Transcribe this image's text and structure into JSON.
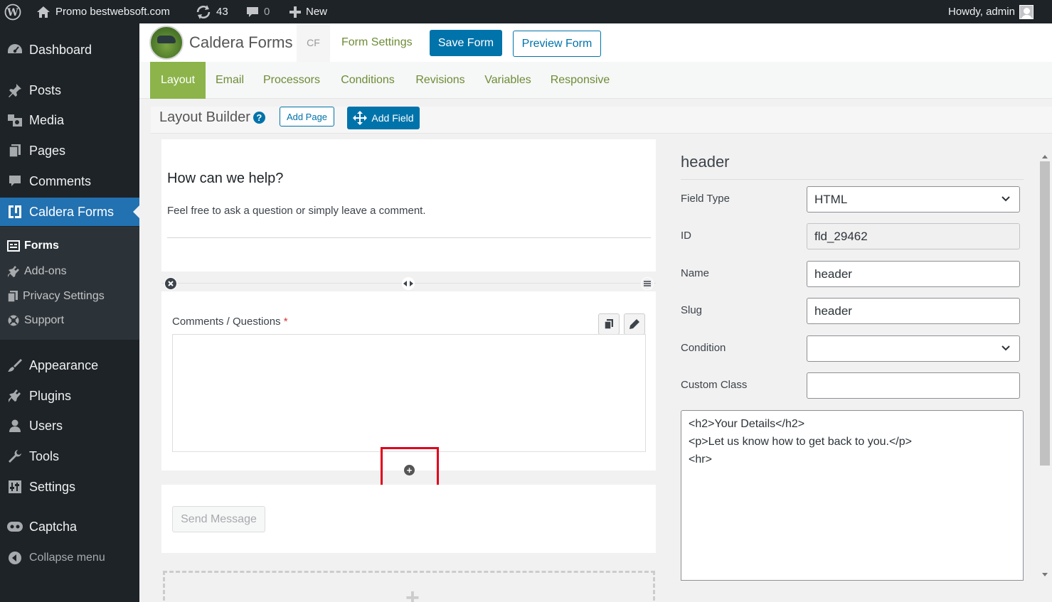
{
  "adminbar": {
    "site_name": "Promo bestwebsoft.com",
    "updates_count": "43",
    "comments_count": "0",
    "new_label": "New",
    "howdy": "Howdy, admin"
  },
  "sidebar": {
    "items": [
      {
        "label": "Dashboard",
        "icon": "dashboard-icon"
      },
      {
        "label": "Posts",
        "icon": "pin-icon"
      },
      {
        "label": "Media",
        "icon": "media-icon"
      },
      {
        "label": "Pages",
        "icon": "pages-icon"
      },
      {
        "label": "Comments",
        "icon": "comment-icon"
      },
      {
        "label": "Caldera Forms",
        "icon": "caldera-icon"
      },
      {
        "label": "Appearance",
        "icon": "brush-icon"
      },
      {
        "label": "Plugins",
        "icon": "plugin-icon"
      },
      {
        "label": "Users",
        "icon": "user-icon"
      },
      {
        "label": "Tools",
        "icon": "wrench-icon"
      },
      {
        "label": "Settings",
        "icon": "settings-icon"
      },
      {
        "label": "Captcha",
        "icon": "captcha-icon"
      }
    ],
    "submenu": [
      {
        "label": "Forms"
      },
      {
        "label": "Add-ons"
      },
      {
        "label": "Privacy Settings"
      },
      {
        "label": "Support"
      }
    ],
    "collapse_label": "Collapse menu"
  },
  "header": {
    "brand": "Caldera Forms",
    "tag": "CF",
    "form_settings": "Form Settings",
    "save_form": "Save Form",
    "preview_form": "Preview Form"
  },
  "tabs": [
    {
      "label": "Layout",
      "active": true
    },
    {
      "label": "Email"
    },
    {
      "label": "Processors"
    },
    {
      "label": "Conditions"
    },
    {
      "label": "Revisions"
    },
    {
      "label": "Variables"
    },
    {
      "label": "Responsive"
    }
  ],
  "builder": {
    "title": "Layout Builder",
    "help": "?",
    "add_page": "Add Page",
    "add_field": "Add Field"
  },
  "canvas": {
    "help_title": "How can we help?",
    "help_desc": "Feel free to ask a question or simply leave a comment.",
    "field_label": "Comments / Questions",
    "required_mark": "*",
    "send_button": "Send Message"
  },
  "config": {
    "title": "header",
    "field_type_label": "Field Type",
    "field_type_value": "HTML",
    "id_label": "ID",
    "id_value": "fld_29462",
    "name_label": "Name",
    "name_value": "header",
    "slug_label": "Slug",
    "slug_value": "header",
    "condition_label": "Condition",
    "condition_value": "",
    "custom_class_label": "Custom Class",
    "custom_class_value": "",
    "code_lines": [
      "<h2>Your Details</h2>",
      "<p>Let us know how to get back to you.</p>",
      "<hr>"
    ]
  },
  "colors": {
    "admin_dark": "#1d2327",
    "accent_blue": "#2271b1",
    "cf_green": "#8cb44a",
    "highlight_red": "#e0001b"
  }
}
